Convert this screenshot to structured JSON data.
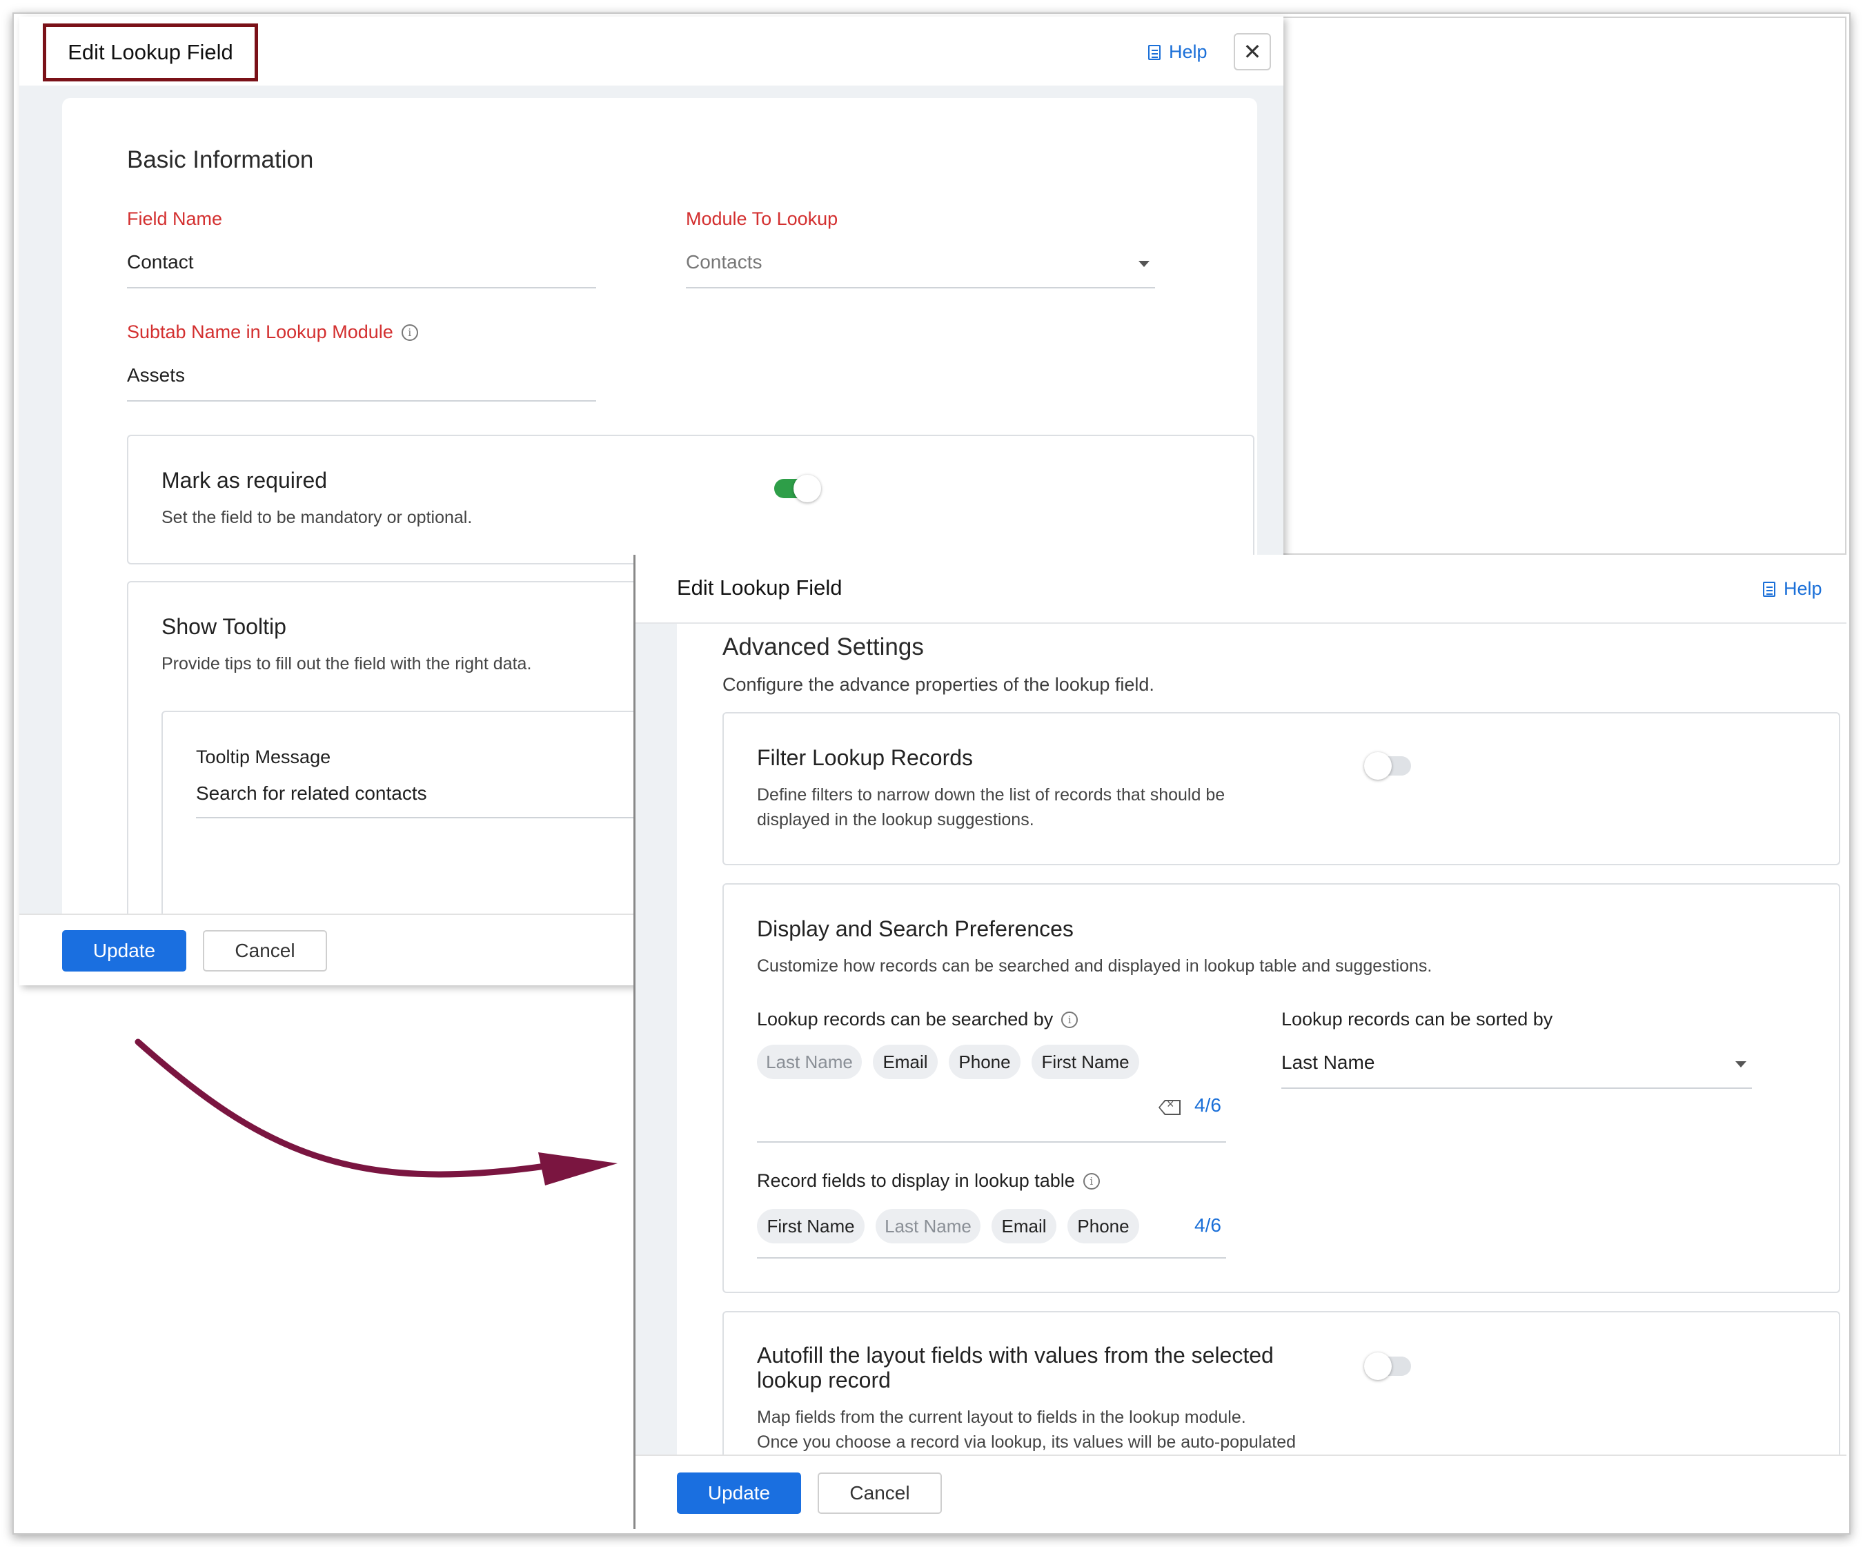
{
  "panel_basic": {
    "title": "Edit Lookup Field",
    "help_label": "Help",
    "close_symbol": "✕",
    "section_title": "Basic Information",
    "field_name": {
      "label": "Field Name",
      "value": "Contact"
    },
    "module_to_lookup": {
      "label": "Module To Lookup",
      "value": "Contacts"
    },
    "subtab_name": {
      "label": "Subtab Name in Lookup Module",
      "value": "Assets"
    },
    "mark_required": {
      "title": "Mark as required",
      "description": "Set the field to be mandatory or optional.",
      "enabled": true
    },
    "show_tooltip": {
      "title": "Show Tooltip",
      "description": "Provide tips to fill out the field with the right data."
    },
    "tooltip_message": {
      "label": "Tooltip Message",
      "value": "Search for related contacts"
    },
    "update_label": "Update",
    "cancel_label": "Cancel"
  },
  "panel_advanced": {
    "title": "Edit Lookup Field",
    "help_label": "Help",
    "section_title": "Advanced Settings",
    "section_desc": "Configure the advance properties of the lookup field.",
    "filter_records": {
      "title": "Filter Lookup Records",
      "desc_line1": "Define filters to narrow down the list of records that should be",
      "desc_line2": "displayed in the lookup suggestions.",
      "enabled": false
    },
    "display_search": {
      "title": "Display and Search Preferences",
      "desc": "Customize how records can be searched and displayed in lookup table and suggestions.",
      "searched_by": {
        "label": "Lookup records can be searched by",
        "chips": [
          "Last Name",
          "Email",
          "Phone",
          "First Name"
        ],
        "counter": "4/6"
      },
      "sorted_by": {
        "label": "Lookup records can be sorted by",
        "value": "Last Name"
      },
      "display_fields": {
        "label": "Record fields to display in lookup table",
        "chips": [
          "First Name",
          "Last Name",
          "Email",
          "Phone"
        ],
        "counter": "4/6"
      }
    },
    "autofill": {
      "title_line1": "Autofill the layout fields with values from the selected",
      "title_line2": "lookup record",
      "desc_line1": "Map fields from the current layout to fields in the lookup module.",
      "desc_line2": "Once you choose a record via lookup, its values will be auto-populated",
      "enabled": false
    },
    "update_label": "Update",
    "cancel_label": "Cancel"
  },
  "colors": {
    "accent": "#1a6fe0",
    "required_label": "#d32f2f",
    "toggle_on": "#2e9e48",
    "highlight_border": "#7a1118",
    "arrow": "#7a1540"
  }
}
